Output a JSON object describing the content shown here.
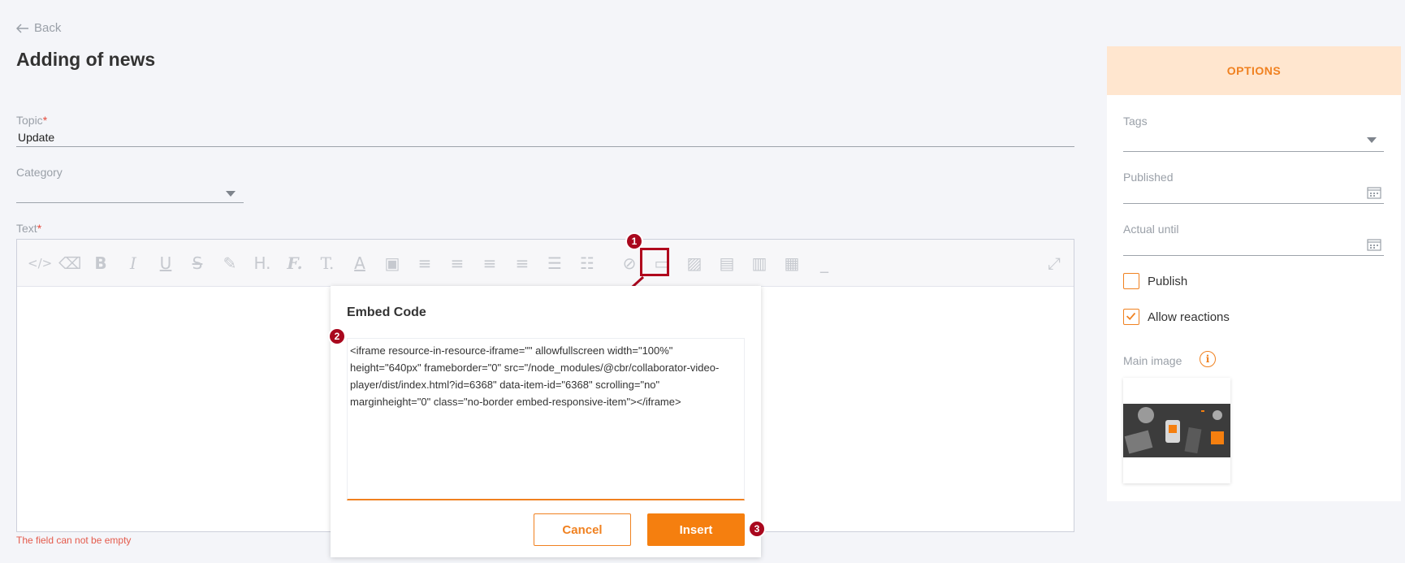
{
  "back_label": "Back",
  "page_title": "Adding of news",
  "form": {
    "topic_label": "Topic",
    "topic_required": "*",
    "topic_value": "Update",
    "category_label": "Category",
    "text_label": "Text",
    "text_required": "*",
    "error": "The field can not be empty"
  },
  "modal": {
    "title": "Embed Code",
    "code": "<iframe resource-in-resource-iframe=\"\" allowfullscreen width=\"100%\" height=\"640px\" frameborder=\"0\" src=\"/node_modules/@cbr/collaborator-video-player/dist/index.html?id=6368\" data-item-id=\"6368\" scrolling=\"no\" marginheight=\"0\" class=\"no-border embed-responsive-item\"></iframe>",
    "cancel_label": "Cancel",
    "insert_label": "Insert"
  },
  "markers": [
    "1",
    "2",
    "3"
  ],
  "options": {
    "header": "OPTIONS",
    "tags_label": "Tags",
    "published_label": "Published",
    "actual_until_label": "Actual until",
    "publish_label": "Publish",
    "publish_checked": false,
    "allow_reactions_label": "Allow reactions",
    "allow_reactions_checked": true,
    "main_image_label": "Main image"
  },
  "toolbar": {
    "icons": [
      "code-view-icon",
      "eraser-icon",
      "bold-icon",
      "italic-icon",
      "underline-icon",
      "strikethrough-icon",
      "paint-format-icon",
      "heading-icon",
      "font-family-icon",
      "font-size-icon",
      "text-color-icon",
      "background-color-icon",
      "align-left-icon",
      "align-center-icon",
      "align-right-icon",
      "align-justify-icon",
      "bullet-list-icon",
      "numbered-list-icon",
      "link-icon",
      "video-embed-icon",
      "image-icon",
      "file-icon",
      "layout-icon",
      "table-icon",
      "horizontal-rule-icon",
      "fullscreen-icon"
    ]
  },
  "colors": {
    "accent": "#f57f0f",
    "marker": "#a9081e",
    "options_header_bg": "#ffe6cf",
    "error": "#e45a4b"
  }
}
